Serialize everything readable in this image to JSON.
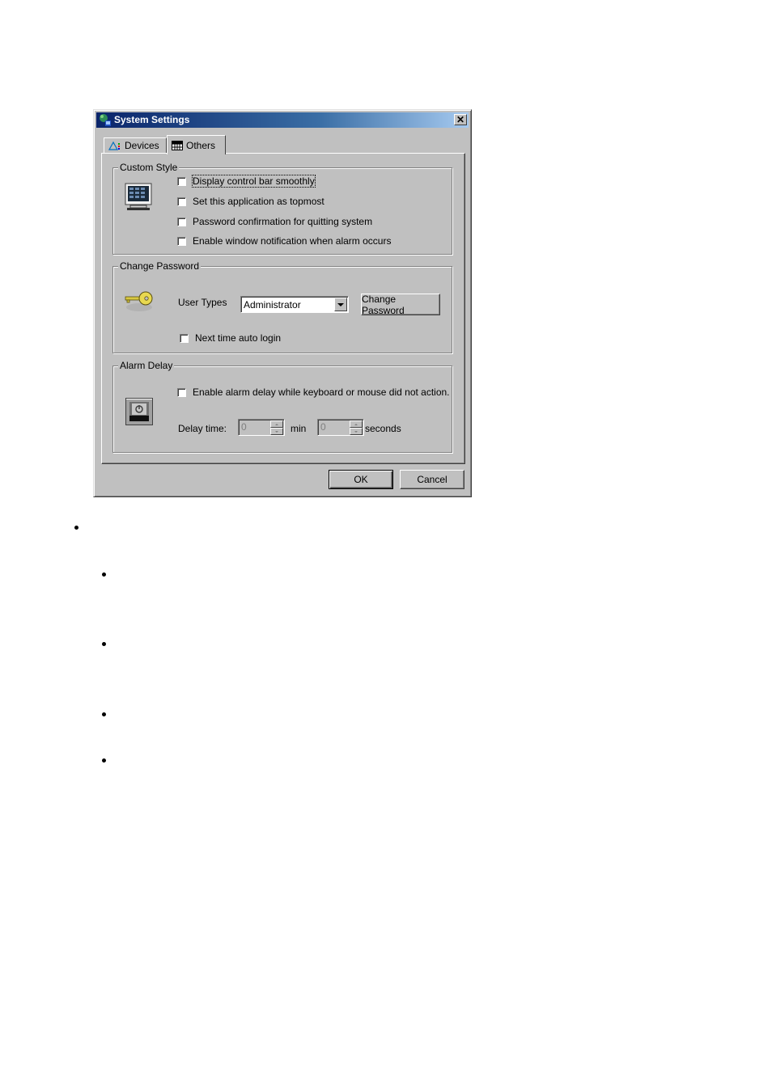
{
  "dialog": {
    "title": "System Settings",
    "close_symbol": "✕",
    "tabs": [
      {
        "label": "Devices",
        "icon": "devices-icon",
        "active": false
      },
      {
        "label": "Others",
        "icon": "grid-icon",
        "active": true
      }
    ],
    "custom_style": {
      "label": "Custom Style",
      "icon": "monitor-icon",
      "options": [
        {
          "label": "Display control bar smoothly",
          "checked": false,
          "focused": true
        },
        {
          "label": "Set this application as topmost",
          "checked": false
        },
        {
          "label": "Password confirmation for quitting system",
          "checked": false
        },
        {
          "label": "Enable window notification when alarm occurs",
          "checked": false
        }
      ]
    },
    "change_password": {
      "label": "Change Password",
      "icon": "key-icon",
      "user_types_label": "User Types",
      "user_types_value": "Administrator",
      "change_button": "Change Password",
      "auto_login_label": "Next time auto login",
      "auto_login_checked": false
    },
    "alarm_delay": {
      "label": "Alarm Delay",
      "icon": "power-icon",
      "enable_label": "Enable alarm delay while keyboard or mouse did not action.",
      "enable_checked": false,
      "delay_time_label": "Delay time:",
      "min_value": "0",
      "min_unit": "min",
      "sec_value": "0",
      "sec_unit": "seconds"
    },
    "ok_button": "OK",
    "cancel_button": "Cancel"
  },
  "page": {
    "bullets": [
      {
        "level": 1
      },
      {
        "level": 2
      },
      {
        "level": 2
      },
      {
        "level": 2
      },
      {
        "level": 2
      }
    ]
  }
}
